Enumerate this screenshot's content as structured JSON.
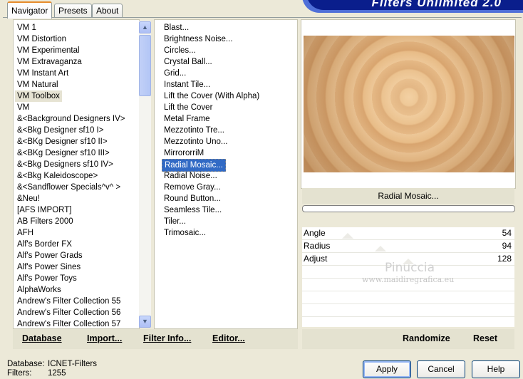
{
  "app": {
    "title": "Filters Unlimited 2.0"
  },
  "tabs": [
    {
      "label": "Navigator",
      "active": true
    },
    {
      "label": "Presets",
      "active": false
    },
    {
      "label": "About",
      "active": false
    }
  ],
  "categories": [
    "VM 1",
    "VM Distortion",
    "VM Experimental",
    "VM Extravaganza",
    "VM Instant Art",
    "VM Natural",
    "VM Toolbox",
    "VM",
    "&<Background Designers IV>",
    "&<Bkg Designer sf10 I>",
    "&<BKg Designer sf10 II>",
    "&<BKg Designer sf10 III>",
    "&<Bkg Designers sf10 IV>",
    "&<Bkg Kaleidoscope>",
    "&<Sandflower Specials^v^ >",
    "&Neu!",
    "[AFS IMPORT]",
    "AB Filters 2000",
    "AFH",
    "Alf's Border FX",
    "Alf's Power Grads",
    "Alf's Power Sines",
    "Alf's Power Toys",
    "AlphaWorks",
    "Andrew's Filter Collection 55",
    "Andrew's Filter Collection 56",
    "Andrew's Filter Collection 57"
  ],
  "selected_category": "VM Toolbox",
  "filters": [
    "Blast...",
    "Brightness Noise...",
    "Circles...",
    "Crystal Ball...",
    "Grid...",
    "Instant Tile...",
    "Lift the Cover (With Alpha)",
    "Lift the Cover",
    "Metal Frame",
    "Mezzotinto Tre...",
    "Mezzotinto Uno...",
    "MirrororriM",
    "Radial Mosaic...",
    "Radial Noise...",
    "Remove Gray...",
    "Round Button...",
    "Seamless Tile...",
    "Tiler...",
    "Trimosaic..."
  ],
  "selected_filter": "Radial Mosaic...",
  "preview": {
    "caption": "Radial Mosaic..."
  },
  "parameters": [
    {
      "label": "Angle",
      "value": "54"
    },
    {
      "label": "Radius",
      "value": "94"
    },
    {
      "label": "Adjust",
      "value": "128"
    }
  ],
  "watermark": {
    "name": "Pinuccia",
    "url": "www.maidiregrafica.eu"
  },
  "left_buttons": {
    "database": "Database",
    "import": "Import...",
    "filter_info": "Filter Info...",
    "editor": "Editor..."
  },
  "right_buttons": {
    "randomize": "Randomize",
    "reset": "Reset"
  },
  "status": {
    "database_label": "Database:",
    "database_value": "ICNET-Filters",
    "filters_label": "Filters:",
    "filters_value": "1255"
  },
  "dialog_buttons": {
    "apply": "Apply",
    "cancel": "Cancel",
    "help": "Help"
  }
}
